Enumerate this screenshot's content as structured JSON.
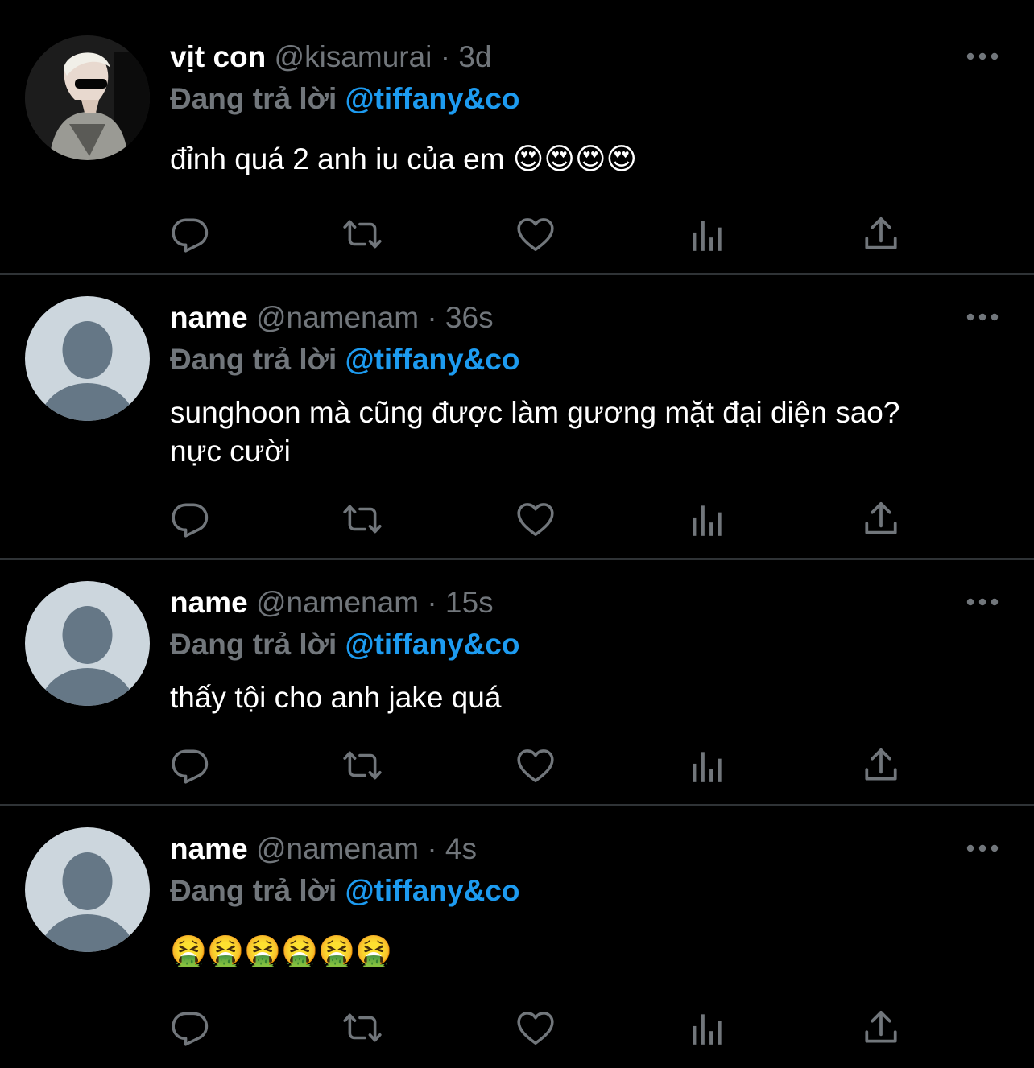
{
  "colors": {
    "background": "#000000",
    "divider": "#2f3336",
    "name": "#ffffff",
    "muted": "#71767b",
    "mention": "#1d9bf0",
    "icon": "#71767b"
  },
  "separator": "·",
  "tweets": [
    {
      "display_name": "vịt con",
      "handle": "@kisamurai",
      "time": "3d",
      "reply_prefix": "Đang trả lời",
      "reply_to": "@tiffany&co",
      "text": "đỉnh quá 2 anh iu của em 😍😍😍😍",
      "avatar": "photo-avatar"
    },
    {
      "display_name": "name",
      "handle": "@namenam",
      "time": "36s",
      "reply_prefix": "Đang trả lời",
      "reply_to": "@tiffany&co",
      "text": "sunghoon mà cũng được làm gương mặt đại diện sao? nực cười",
      "avatar": "default-avatar"
    },
    {
      "display_name": "name",
      "handle": "@namenam",
      "time": "15s",
      "reply_prefix": "Đang trả lời",
      "reply_to": "@tiffany&co",
      "text": "thấy tội cho anh jake quá",
      "avatar": "default-avatar"
    },
    {
      "display_name": "name",
      "handle": "@namenam",
      "time": "4s",
      "reply_prefix": "Đang trả lời",
      "reply_to": "@tiffany&co",
      "text": "🤮🤮🤮🤮🤮🤮",
      "avatar": "default-avatar"
    }
  ],
  "action_icons": [
    "reply-icon",
    "retweet-icon",
    "like-icon",
    "analytics-icon",
    "share-icon"
  ]
}
